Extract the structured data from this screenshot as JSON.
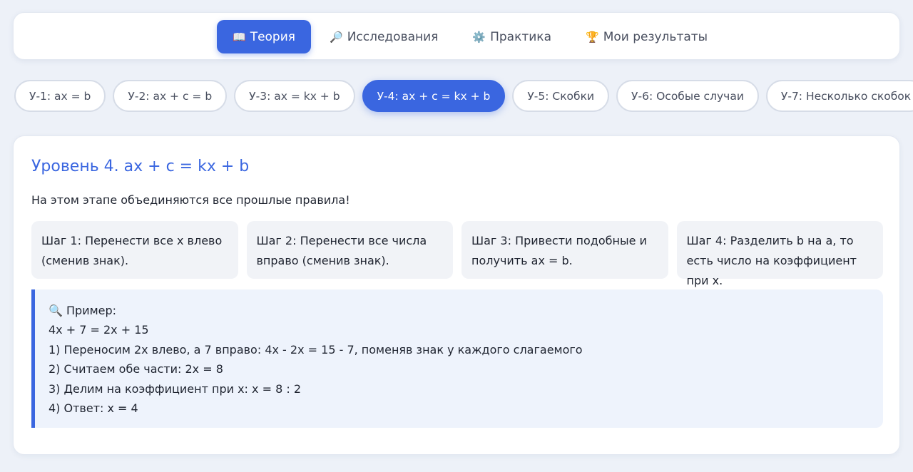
{
  "nav": {
    "items": [
      {
        "icon": "📖",
        "label": "Теория",
        "active": true
      },
      {
        "icon": "🔎",
        "label": "Исследования",
        "active": false
      },
      {
        "icon": "⚙️",
        "label": "Практика",
        "active": false
      },
      {
        "icon": "🏆",
        "label": "Мои результаты",
        "active": false
      }
    ]
  },
  "levels": [
    {
      "label": "У-1: ax = b",
      "active": false
    },
    {
      "label": "У-2: ax + c = b",
      "active": false
    },
    {
      "label": "У-3: ax = kx + b",
      "active": false
    },
    {
      "label": "У-4: ax + c = kx + b",
      "active": true
    },
    {
      "label": "У-5: Скобки",
      "active": false
    },
    {
      "label": "У-6: Особые случаи",
      "active": false
    },
    {
      "label": "У-7: Несколько скобок",
      "active": false
    }
  ],
  "theory": {
    "title": "Уровень 4. ax + c = kx + b",
    "intro": "На этом этапе объединяются все прошлые правила!",
    "steps": [
      "Шаг 1: Перенести все x влево (сменив знак).",
      "Шаг 2: Перенести все числа вправо (сменив знак).",
      "Шаг 3: Привести подобные и получить ax = b.",
      "Шаг 4: Разделить b на a, то есть число на коэффициент при x."
    ],
    "example": {
      "icon": "🔍",
      "heading": "Пример:",
      "lines": [
        "4x + 7 = 2x + 15",
        "1) Переносим 2x влево, а 7 вправо: 4x - 2x = 15 - 7, поменяв знак у каждого слагаемого",
        "2) Считаем обе части: 2x = 8",
        "3) Делим на коэффициент при x: x = 8 : 2",
        "4) Ответ: x = 4"
      ]
    }
  },
  "colors": {
    "accent": "#3a66e0",
    "background": "#edf1f8",
    "step_bg": "#f1f3f7",
    "example_bg": "#eef3fc"
  }
}
